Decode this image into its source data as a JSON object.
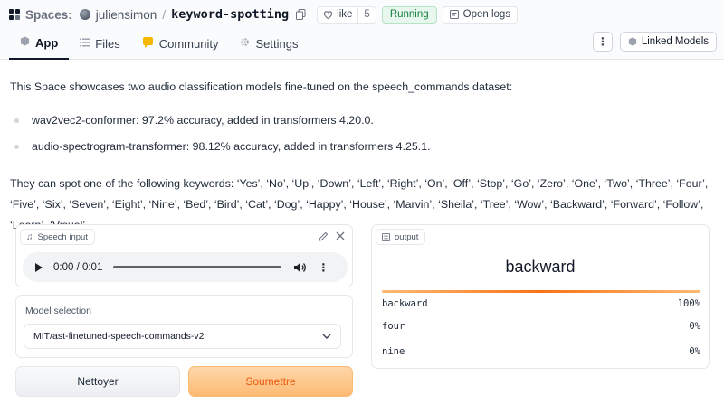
{
  "header": {
    "spaces_label": "Spaces:",
    "owner": "juliensimon",
    "separator": "/",
    "repo": "keyword-spotting",
    "like_label": "like",
    "like_count": "5",
    "status": "Running",
    "open_logs": "Open logs",
    "tabs": [
      {
        "label": "App",
        "icon": "app-icon"
      },
      {
        "label": "Files",
        "icon": "files-icon"
      },
      {
        "label": "Community",
        "icon": "community-icon"
      },
      {
        "label": "Settings",
        "icon": "gear-icon"
      }
    ],
    "more": "⋮",
    "linked_models": "Linked Models"
  },
  "description": {
    "intro": "This Space showcases two audio classification models fine-tuned on the speech_commands dataset:",
    "bullets": [
      "wav2vec2-conformer: 97.2% accuracy, added in transformers 4.20.0.",
      "audio-spectrogram-transformer: 98.12% accuracy, added in transformers 4.25.1."
    ],
    "keywords": "They can spot one of the following keywords: ‘Yes’, ‘No’, ‘Up’, ‘Down’, ‘Left’, ‘Right’, ‘On’, ‘Off’, ‘Stop’, ‘Go’, ‘Zero’, ‘One’, ‘Two’, ‘Three’, ‘Four’, ‘Five’, ‘Six’, ‘Seven’, ‘Eight’, ‘Nine’, ‘Bed’, ‘Bird’, ‘Cat’, ‘Dog’, ‘Happy’, ‘House’, ‘Marvin’, ‘Sheila’, ‘Tree’, ‘Wow’, ‘Backward’, ‘Forward’, ‘Follow’, ‘Learn’, ‘Visual’."
  },
  "speech_input": {
    "label": "Speech input",
    "time": "0:00 / 0:01"
  },
  "model_selection": {
    "label": "Model selection",
    "value": "MIT/ast-finetuned-speech-commands-v2"
  },
  "buttons": {
    "clear": "Nettoyer",
    "submit": "Soumettre"
  },
  "output": {
    "label": "output",
    "top_label": "backward",
    "confidences": [
      {
        "label": "backward",
        "value": "100%",
        "fraction": 1.0
      },
      {
        "label": "four",
        "value": "0%",
        "fraction": 0.0
      },
      {
        "label": "nine",
        "value": "0%",
        "fraction": 0.0
      }
    ]
  },
  "colors": {
    "accent_orange": "#f97316",
    "running_green": "#15803d"
  }
}
